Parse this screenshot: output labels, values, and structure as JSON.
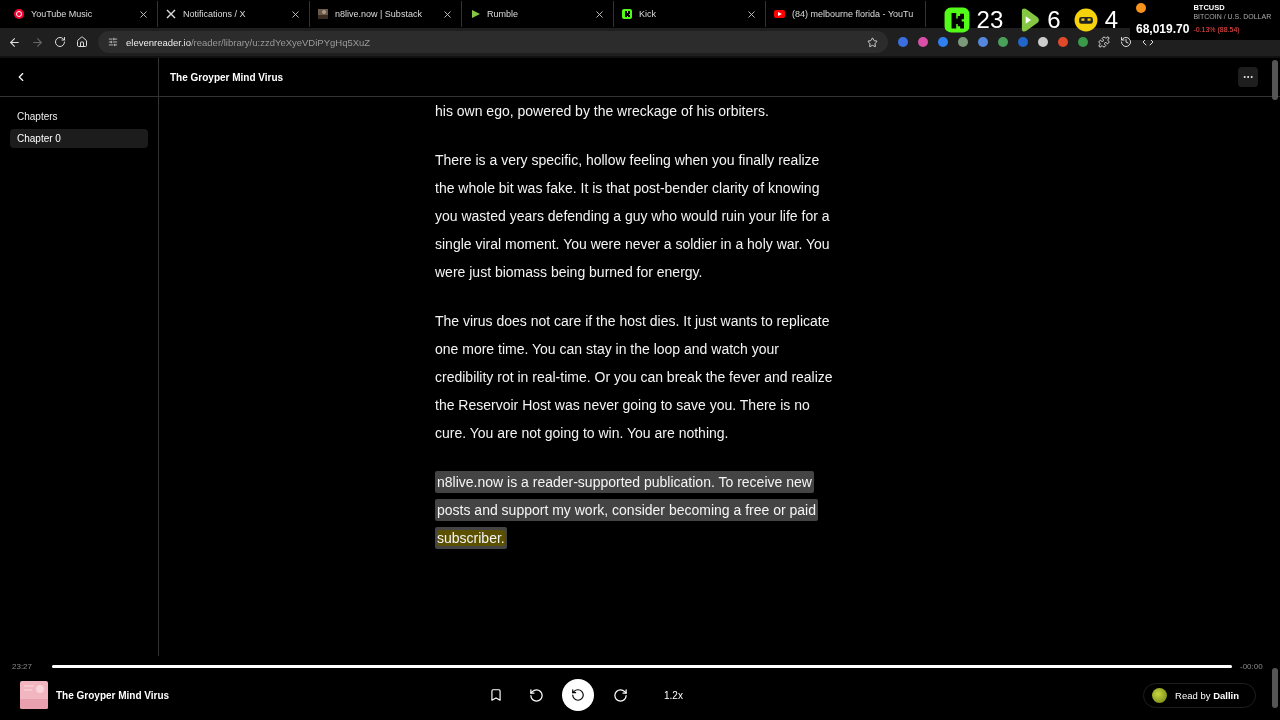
{
  "browser": {
    "tabs": [
      {
        "title": "YouTube Music",
        "kind": "ytmusic",
        "selected": false
      },
      {
        "title": "Notifications / X",
        "kind": "x",
        "selected": false
      },
      {
        "title": "n8live.now | Substack",
        "kind": "thumb",
        "selected": false
      },
      {
        "title": "Rumble",
        "kind": "rumble",
        "selected": false
      },
      {
        "title": "Kick",
        "kind": "kick",
        "selected": false
      },
      {
        "title": "(84) melbourne florida - YouTu",
        "kind": "youtube",
        "selected": false
      }
    ],
    "url_host": "elevenreader.io",
    "url_path": "/reader/library/u:zzdYeXyeVDiPYgHq5XuZ"
  },
  "overlay": {
    "counters": [
      {
        "kind": "kick",
        "count": "23"
      },
      {
        "kind": "rumble",
        "count": "6"
      },
      {
        "kind": "other",
        "count": "4"
      }
    ],
    "ticker": {
      "symbol": "BTCUSD",
      "name": "BITCOIN / U.S. DOLLAR",
      "price": "68,019.70",
      "change": "-0.13% (88.54)"
    }
  },
  "header": {
    "title": "The Groyper Mind Virus"
  },
  "sidebar": {
    "heading": "Chapters",
    "items": [
      {
        "label": "Chapter 0",
        "selected": true
      }
    ]
  },
  "paragraphs": [
    {
      "text": "his own ego, powered by the wreckage of his orbiters."
    },
    {
      "text": "There is a very specific, hollow feeling when you finally realize the whole bit was fake. It is that post-bender clarity of knowing you wasted years defending a guy who would ruin your life for a single viral moment. You were never a soldier in a holy war. You were just biomass being burned for energy."
    },
    {
      "text": "The virus does not care if the host dies. It just wants to replicate one more time. You can stay in the loop and watch your credibility rot in real-time. Or you can break the fever and realize the Reservoir Host was never going to save you. There is no cure. You are not going to win. You are nothing."
    },
    {
      "text": "n8live.now is a reader-supported publication. To receive new posts and support my work, consider becoming a free or paid ",
      "current_word": "subscriber.",
      "selected": true
    }
  ],
  "player": {
    "elapsed": "23:27",
    "remaining": "-00:00",
    "level": 1,
    "title": "The Groyper Mind Virus",
    "speed": "1.2x",
    "narrator": "Read by **Dallin**"
  }
}
